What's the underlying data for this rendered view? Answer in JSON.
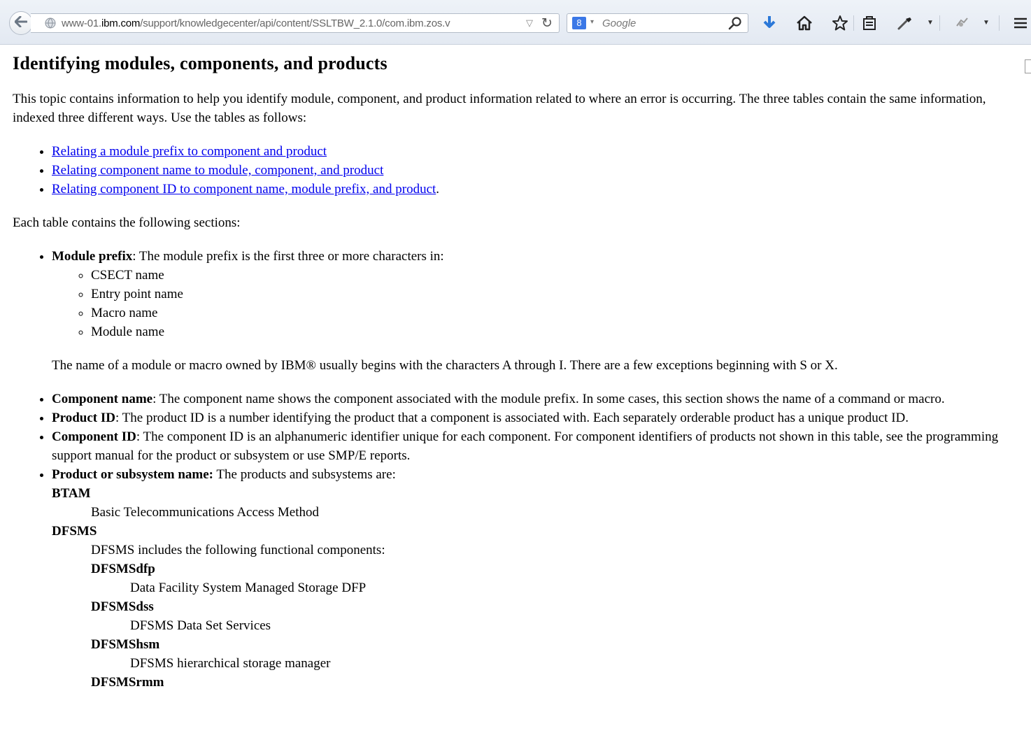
{
  "browser": {
    "url_host_prefix": "www-01.",
    "url_host_domain": "ibm.com",
    "url_path": "/support/knowledgecenter/api/content/SSLTBW_2.1.0/com.ibm.zos.v",
    "search_engine_label": "8",
    "search_placeholder": "Google",
    "icons": [
      "back-arrow-icon",
      "globe-icon",
      "url-dropdown-icon",
      "reload-icon",
      "search-engine-icon",
      "search-magnifier-icon",
      "download-icon",
      "home-icon",
      "bookmark-star-icon",
      "reading-list-icon",
      "tool-icon",
      "addon-icon",
      "menu-icon"
    ]
  },
  "page": {
    "title": "Identifying modules, components, and products",
    "intro": "This topic contains information to help you identify module, component, and product information related to where an error is occurring. The three tables contain the same information, indexed three different ways. Use the tables as follows:",
    "links": [
      "Relating a module prefix to component and product",
      "Relating component name to module, component, and product",
      "Relating component ID to component name, module prefix, and product"
    ],
    "links_trailing": ".",
    "sections_intro": "Each table contains the following sections:",
    "sections": {
      "module_prefix": {
        "term": "Module prefix",
        "text": ": The module prefix is the first three or more characters in:",
        "items": [
          "CSECT name",
          "Entry point name",
          "Macro name",
          "Module name"
        ],
        "note": "The name of a module or macro owned by IBM® usually begins with the characters A through I. There are a few exceptions beginning with S or X."
      },
      "component_name": {
        "term": "Component name",
        "text": ": The component name shows the component associated with the module prefix. In some cases, this section shows the name of a command or macro."
      },
      "product_id": {
        "term": "Product ID",
        "text": ": The product ID is a number identifying the product that a component is associated with. Each separately orderable product has a unique product ID."
      },
      "component_id": {
        "term": "Component ID",
        "text": ": The component ID is an alphanumeric identifier unique for each component. For component identifiers of products not shown in this table, see the programming support manual for the product or subsystem or use SMP/E reports."
      },
      "product_name": {
        "term": "Product or subsystem name:",
        "text": " The products and subsystems are:"
      }
    },
    "products": {
      "btam": {
        "term": "BTAM",
        "desc": "Basic Telecommunications Access Method"
      },
      "dfsms": {
        "term": "DFSMS",
        "desc": "DFSMS includes the following functional components:",
        "components": [
          {
            "term": "DFSMSdfp",
            "desc": "Data Facility System Managed Storage DFP"
          },
          {
            "term": "DFSMSdss",
            "desc": "DFSMS Data Set Services"
          },
          {
            "term": "DFSMShsm",
            "desc": "DFSMS hierarchical storage manager"
          },
          {
            "term": "DFSMSrmm",
            "desc": ""
          }
        ]
      }
    }
  }
}
